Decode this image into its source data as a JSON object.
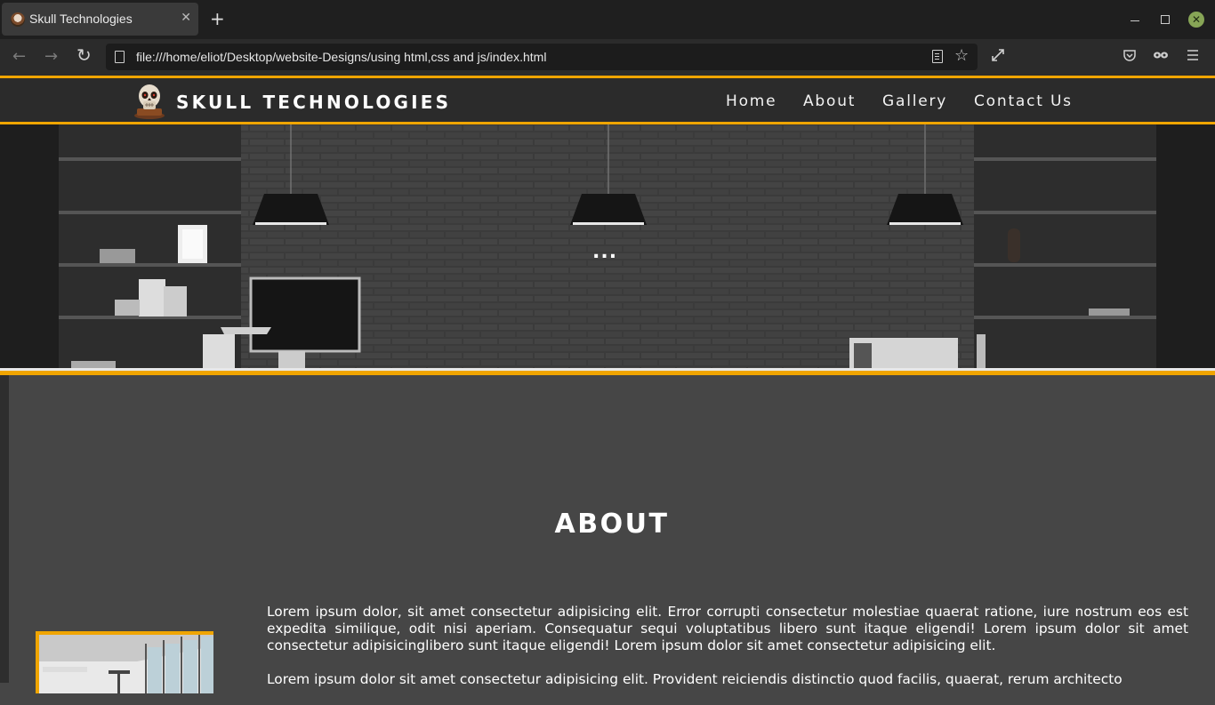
{
  "browser": {
    "tab_title": "Skull Technologies",
    "tab_close": "✕",
    "new_tab": "+",
    "url": "file:///home/eliot/Desktop/website-Designs/using html,css and js/index.html",
    "back": "←",
    "forward": "→",
    "reload": "↻",
    "window_close": "✕"
  },
  "site": {
    "brand": "SKULL TECHNOLOGIES",
    "nav": [
      "Home",
      "About",
      "Gallery",
      "Contact Us"
    ],
    "accent_color": "#f0a500"
  },
  "hero": {
    "dots": "..."
  },
  "about": {
    "title": "ABOUT",
    "paragraphs": [
      "Lorem ipsum dolor, sit amet consectetur adipisicing elit. Error corrupti consectetur molestiae quaerat ratione, iure nostrum eos est expedita similique, odit nisi aperiam. Consequatur sequi voluptatibus libero sunt itaque eligendi! Lorem ipsum dolor sit amet consectetur adipisicinglibero sunt itaque eligendi! Lorem ipsum dolor sit amet consectetur adipisicing elit.",
      "Lorem ipsum dolor sit amet consectetur adipisicing elit. Provident reiciendis distinctio quod facilis, quaerat, rerum architecto"
    ]
  }
}
